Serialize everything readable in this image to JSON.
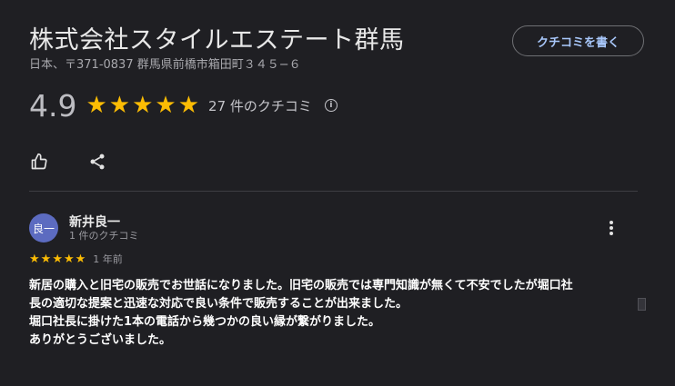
{
  "business": {
    "name": "株式会社スタイルエステート群馬",
    "address": "日本、〒371-0837 群馬県前橋市箱田町３４５−６"
  },
  "write_review_label": "クチコミを書く",
  "rating": {
    "score": "4.9",
    "stars": 5,
    "count_label": "27 件のクチコミ",
    "info_glyph": "i"
  },
  "icons": {
    "like": "thumbs-up-icon",
    "share": "share-icon",
    "info": "info-icon",
    "more": "more-vert-icon",
    "star": "star-icon"
  },
  "review": {
    "avatar_text": "良一",
    "avatar_color": "#5c6bc0",
    "author": "新井良一",
    "author_meta": "1 件のクチコミ",
    "stars": 5,
    "date": "1 年前",
    "text_lines": [
      "新居の購入と旧宅の販売でお世話になりました。旧宅の販売では専門知識が無くて不安でしたが堀口社",
      "長の適切な提案と迅速な対応で良い条件で販売することが出来ました。",
      "堀口社長に掛けた1本の電話から幾つかの良い縁が繋がりました。",
      "ありがとうございました。"
    ]
  },
  "colors": {
    "background": "#1f1f23",
    "star": "#fbbc04",
    "accent": "#a8c7fa"
  }
}
